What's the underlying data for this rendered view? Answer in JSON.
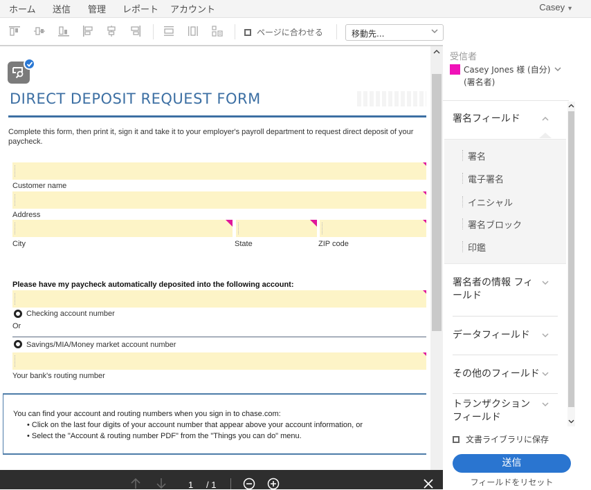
{
  "nav": {
    "items": [
      "ホーム",
      "送信",
      "管理",
      "レポート",
      "アカウント"
    ],
    "user": "Casey"
  },
  "toolbar": {
    "align_icons": [
      "align-top-icon",
      "align-middle-icon",
      "align-bottom-icon",
      "align-left-icon",
      "align-center-icon",
      "align-right-icon"
    ],
    "distribute_icons": [
      "distribute-horizontal-icon",
      "distribute-vertical-icon",
      "match-size-icon"
    ],
    "fit_page_label": "ページに合わせる",
    "fit_page_checked": false,
    "goto_value": "移動先..."
  },
  "document": {
    "title": "DIRECT DEPOSIT REQUEST FORM",
    "intro": "Complete this form, then print it, sign it and take it to your employer's payroll department to request direct deposit of your paycheck.",
    "labels": {
      "customer_name": "Customer name",
      "address": "Address",
      "city": "City",
      "state": "State",
      "zip": "ZIP code"
    },
    "deposit_heading": "Please have my paycheck automatically deposited into the following account:",
    "checking_label": "Checking account number",
    "or_label": "Or",
    "savings_label": "Savings/MIA/Money market account number",
    "routing_label": "Your bank's routing number",
    "info": {
      "lead": "You can find your account and routing numbers when you sign in to chase.com:",
      "bullets": [
        "• Click on the last four digits of your account number that appear above your account information, or",
        "• Select the \"Account & routing number PDF\" from the \"Things you can do\" menu."
      ]
    }
  },
  "pager": {
    "current": "1",
    "total": "/ 1"
  },
  "panel": {
    "recipients_heading": "受信者",
    "recipient": {
      "name": "Casey Jones 様 (自分) (署名者)",
      "color": "#f012b8"
    },
    "sections": {
      "signature": "署名フィールド",
      "signer_info": "署名者の情報 フィールド",
      "data": "データフィールド",
      "other": "その他のフィールド",
      "transaction": "トランザクション フィールド"
    },
    "signature_items": [
      "署名",
      "電子署名",
      "イニシャル",
      "署名ブロック",
      "印鑑"
    ],
    "save_library_label": "文書ライブラリに保存",
    "save_library_checked": false,
    "send_label": "送信",
    "reset_label": "フィールドをリセット"
  },
  "colors": {
    "accent": "#2a75d0",
    "title_blue": "#3c6fa3",
    "field_fill": "#fdf4c7",
    "field_flag": "#e0179b"
  }
}
